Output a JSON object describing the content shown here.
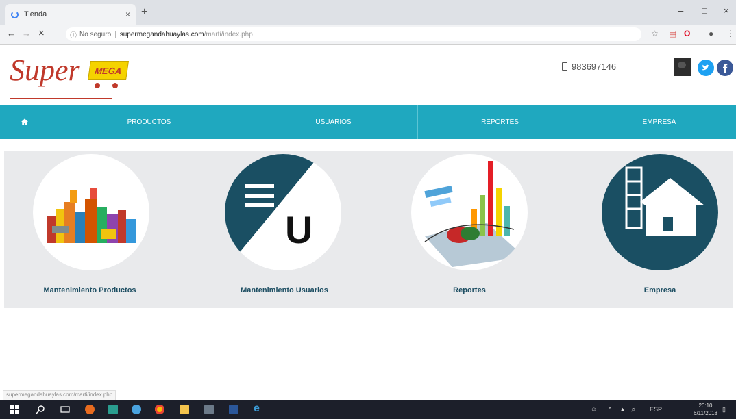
{
  "browser": {
    "tab_title": "Tienda",
    "tab_close": "×",
    "new_tab": "+",
    "url_secure_label": "No seguro",
    "url_host": "supermegandahuaylas.com",
    "url_path": "/marti/index.php"
  },
  "site": {
    "logo_text_super": "Super",
    "logo_text_mega": "MEGA",
    "phone": "983697146"
  },
  "menu": {
    "items": [
      "PRODUCTOS",
      "USUARIOS",
      "REPORTES",
      "EMPRESA"
    ]
  },
  "cards": [
    {
      "caption": "Mantenimiento Productos"
    },
    {
      "caption": "Mantenimiento Usuarios",
      "icon_letter": "U"
    },
    {
      "caption": "Reportes"
    },
    {
      "caption": "Empresa"
    }
  ],
  "status_bar": {
    "url": "supermegandahuaylas.com/marti/index.php"
  },
  "taskbar": {
    "language": "ESP",
    "time": "20:10",
    "date": "6/11/2018"
  },
  "colors": {
    "menu_bg": "#1fa8bf",
    "dark_teal": "#1a4f63",
    "content_bg": "#e9eaec",
    "logo_red": "#c0392b",
    "logo_yellow": "#f5d300"
  }
}
